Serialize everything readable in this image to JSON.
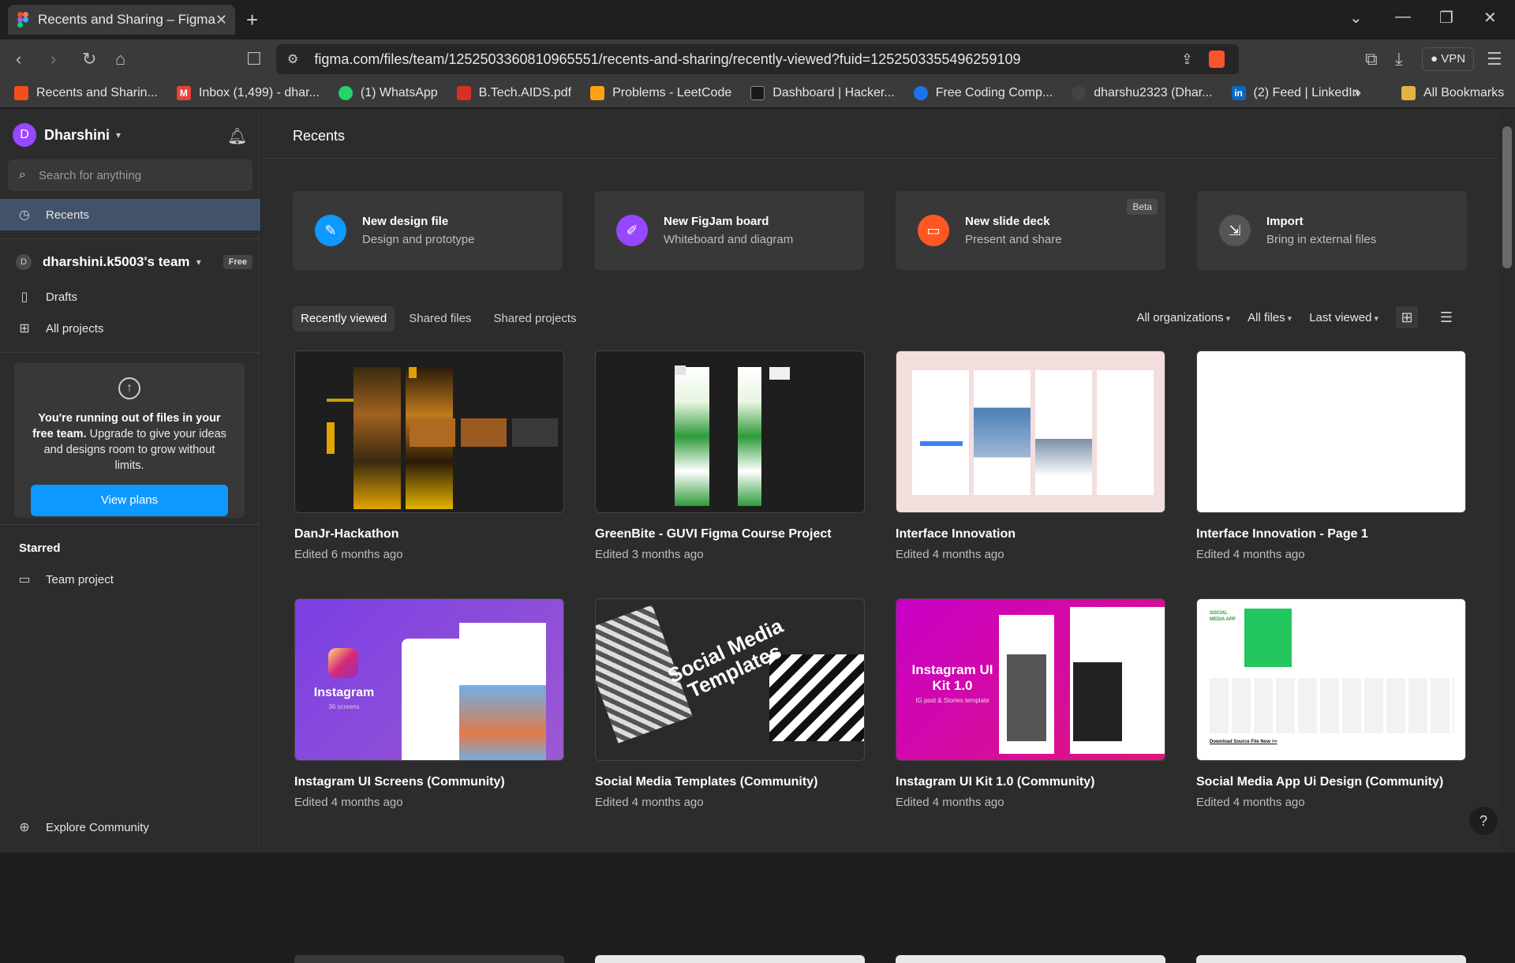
{
  "browser": {
    "tab_title": "Recents and Sharing – Figma",
    "url": "figma.com/files/team/1252503360810965551/recents-and-sharing/recently-viewed?fuid=1252503355496259109",
    "vpn_label": "VPN",
    "bookmarks": [
      {
        "label": "Recents and Sharin...",
        "color": "#f24e1e",
        "icon": "figma-icon"
      },
      {
        "label": "Inbox (1,499) - dhar...",
        "color": "#ea4335",
        "icon": "gmail-icon"
      },
      {
        "label": "(1) WhatsApp",
        "color": "#25d366",
        "icon": "whatsapp-icon"
      },
      {
        "label": "B.Tech.AIDS.pdf",
        "color": "#d93025",
        "icon": "pdf-icon"
      },
      {
        "label": "Problems - LeetCode",
        "color": "#ffa116",
        "icon": "leetcode-icon"
      },
      {
        "label": "Dashboard | Hacker...",
        "color": "#1a1a1a",
        "icon": "hackerrank-icon"
      },
      {
        "label": "Free Coding Comp...",
        "color": "#1a73e8",
        "icon": "codechef-icon"
      },
      {
        "label": "dharshu2323 (Dhar...",
        "color": "#444444",
        "icon": "github-icon"
      },
      {
        "label": "(2) Feed | LinkedIn",
        "color": "#0a66c2",
        "icon": "linkedin-icon"
      }
    ],
    "all_bookmarks": "All Bookmarks"
  },
  "sidebar": {
    "avatar_letter": "D",
    "user_name": "Dharshini",
    "search_placeholder": "Search for anything",
    "recents": "Recents",
    "team_avatar": "D",
    "team_name": "dharshini.k5003's team",
    "team_badge": "Free",
    "drafts": "Drafts",
    "all_projects": "All projects",
    "upgrade_bold": "You're running out of files in your free team.",
    "upgrade_rest": " Upgrade to give your ideas and designs room to grow without limits.",
    "view_plans": "View plans",
    "starred": "Starred",
    "team_project": "Team project",
    "explore": "Explore Community"
  },
  "main": {
    "title": "Recents",
    "actions": [
      {
        "title": "New design file",
        "subtitle": "Design and prototype",
        "color": "#0d99ff",
        "icon": "pen-icon"
      },
      {
        "title": "New FigJam board",
        "subtitle": "Whiteboard and diagram",
        "color": "#9747ff",
        "icon": "marker-icon"
      },
      {
        "title": "New slide deck",
        "subtitle": "Present and share",
        "color": "#ff5722",
        "icon": "slides-icon",
        "badge": "Beta"
      },
      {
        "title": "Import",
        "subtitle": "Bring in external files",
        "color": "#555555",
        "icon": "import-icon"
      }
    ],
    "tabs": [
      "Recently viewed",
      "Shared files",
      "Shared projects"
    ],
    "filters": [
      "All organizations",
      "All files",
      "Last viewed"
    ],
    "files": [
      {
        "name": "DanJr-Hackathon",
        "edited": "Edited 6 months ago"
      },
      {
        "name": "GreenBite - GUVI Figma Course Project",
        "edited": "Edited 3 months ago"
      },
      {
        "name": "Interface Innovation",
        "edited": "Edited 4 months ago"
      },
      {
        "name": "Interface Innovation - Page 1",
        "edited": "Edited 4 months ago"
      },
      {
        "name": "Instagram UI Screens (Community)",
        "edited": "Edited 4 months ago",
        "thumb_title": "Instagram",
        "thumb_sub": "36 screens"
      },
      {
        "name": "Social Media Templates (Community)",
        "edited": "Edited 4 months ago",
        "thumb_title": "Social Media Templates"
      },
      {
        "name": "Instagram UI Kit 1.0 (Community)",
        "edited": "Edited 4 months ago",
        "thumb_title": "Instagram UI Kit 1.0",
        "thumb_sub": "IG post & Stories template"
      },
      {
        "name": "Social Media App Ui Design (Community)",
        "edited": "Edited 4 months ago",
        "thumb_title": "SOCIAL MEDIA APP",
        "thumb_sub": "Download Source File Now >>"
      }
    ],
    "help": "?"
  }
}
